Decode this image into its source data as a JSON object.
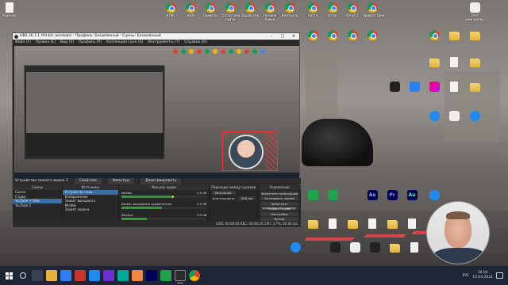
{
  "obs": {
    "title": "OBS 26.1.1 (64-bit, windows) - Профиль: Безымянный - Сцены: Безымянный",
    "menu": [
      "Файл (F)",
      "Правка (E)",
      "Вид (V)",
      "Профиль (P)",
      "Коллекция сцен (S)",
      "Инструменты (T)",
      "Справка (H)"
    ],
    "toolbar": {
      "label": "Устройство захвата видео 2",
      "props": "Свойства",
      "filters": "Фильтры",
      "deactivate": "Деактивировать"
    },
    "docks": {
      "scenes": {
        "title": "Сцены",
        "items": [
          "Сцена",
          "Стрим",
          "YouTube + Web",
          "YouTube 2"
        ],
        "selected": 2
      },
      "sources": {
        "title": "Источники",
        "items": [
          "Устройство захв...",
          "Изображение",
          "Захват выходного",
          "MicNes",
          "Захват экрана"
        ],
        "selected": 0
      },
      "mixer": {
        "title": "Микшер аудио",
        "channels": [
          {
            "name": "MicNes",
            "db": "0.0 dB",
            "level": 0.62
          },
          {
            "name": "Захват выходного аудиопотока",
            "db": "0.0 dB",
            "level": 0.48
          },
          {
            "name": "Mic/Aux",
            "db": "0.0 dB",
            "level": 0.3
          }
        ]
      },
      "transitions": {
        "title": "Переходы между сценами",
        "type_label": "Затухание",
        "duration_label": "Длительность",
        "duration": "300 ms"
      },
      "controls": {
        "title": "Управление",
        "buttons": [
          "Запустить трансляцию",
          "Остановить запись",
          "Запустить виртуальную камеру",
          "Режим студии",
          "Настройки",
          "Выход"
        ]
      }
    },
    "status": "LIVE: 00:00:00    REC: 00:00:20    CPU: 3.7%, 60.00 fps"
  },
  "desktop": {
    "icons": [
      {
        "label": "Корзина",
        "type": "doc"
      },
      {
        "label": "HTML",
        "type": "chrome"
      },
      {
        "label": "HDR",
        "type": "chrome"
      },
      {
        "label": "Приветы",
        "type": "chrome"
      },
      {
        "label": "Статистика сайта",
        "type": "chrome"
      },
      {
        "label": "Заработок",
        "type": "chrome"
      },
      {
        "label": "Лучшие блоки",
        "type": "chrome"
      },
      {
        "label": "Контроль",
        "type": "chrome"
      },
      {
        "label": "Почта",
        "type": "chrome"
      },
      {
        "label": "Ютуб",
        "type": "chrome"
      },
      {
        "label": "Ютуб 2",
        "type": "chrome"
      },
      {
        "label": "Приветствие",
        "type": "chrome"
      },
      {
        "label": "Этот компьютер",
        "type": "doc"
      },
      {
        "label": "Ae",
        "type": "ae"
      },
      {
        "label": "Pr",
        "type": "pr"
      },
      {
        "label": "Au",
        "type": "au"
      }
    ]
  },
  "taskbar": {
    "time": "16:04",
    "date": "15.04.2021",
    "lang": "РУС"
  }
}
